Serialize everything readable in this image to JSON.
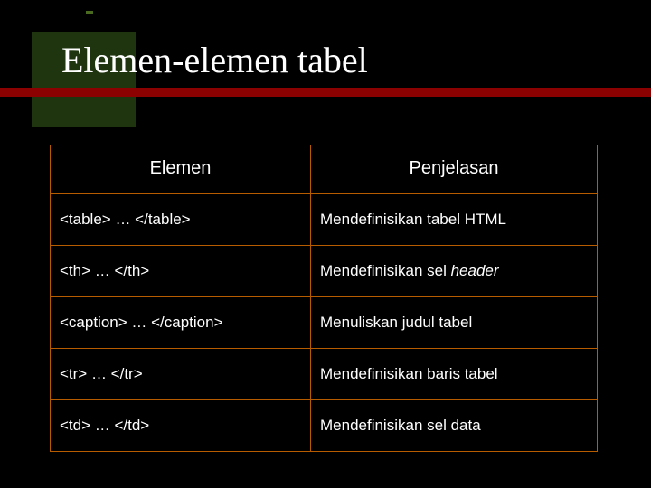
{
  "slide": {
    "title": "Elemen-elemen tabel"
  },
  "table": {
    "headers": {
      "col1": "Elemen",
      "col2": "Penjelasan"
    },
    "rows": [
      {
        "elemen": "<table> … </table>",
        "penjelasan_pre": "Mendefinisikan tabel HTML",
        "penjelasan_ital": ""
      },
      {
        "elemen": "<th> … </th>",
        "penjelasan_pre": "Mendefinisikan sel ",
        "penjelasan_ital": "header"
      },
      {
        "elemen": "<caption> … </caption>",
        "penjelasan_pre": "Menuliskan judul tabel",
        "penjelasan_ital": ""
      },
      {
        "elemen": "<tr> … </tr>",
        "penjelasan_pre": "Mendefinisikan baris tabel",
        "penjelasan_ital": ""
      },
      {
        "elemen": "<td> … </td>",
        "penjelasan_pre": "Mendefinisikan sel data",
        "penjelasan_ital": ""
      }
    ]
  }
}
